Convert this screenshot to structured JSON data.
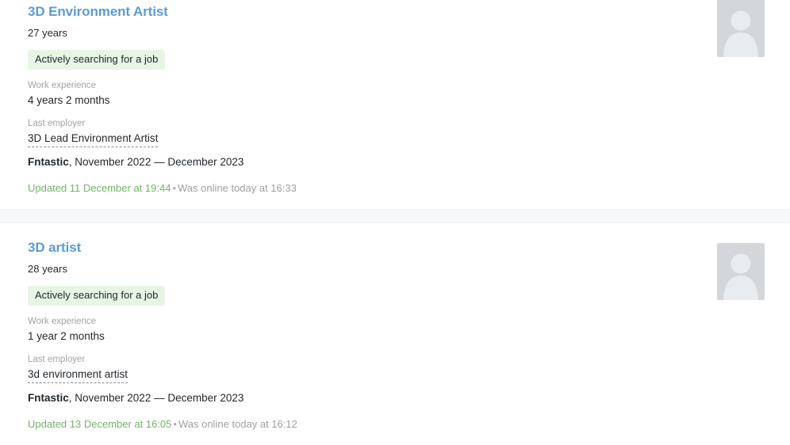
{
  "page": {
    "accent_blue": "#5b9bd5",
    "badge_bg": "#e7f5e5",
    "updated_green": "#73b369",
    "muted_gray": "#a3a3a3",
    "avatar_bg": "#d3d7d9",
    "divider_bg": "#f7f8fa"
  },
  "labels": {
    "work_experience": "Work experience",
    "last_employer": "Last employer",
    "separator": "•"
  },
  "resumes": [
    {
      "title": "3D Environment Artist",
      "age": "27 years",
      "status": "Actively searching for a job",
      "experience_label": "Work experience",
      "experience": "4 years 2 months",
      "employer_label": "Last employer",
      "position": "3D Lead Environment Artist",
      "company": "Fntastic",
      "period": ", November 2022 — December 2023",
      "updated": "Updated 11 December at 19:44",
      "separator": "•",
      "online": "Was online today at 16:33",
      "avatar_icon": "user-placeholder-icon"
    },
    {
      "title": "3D artist",
      "age": "28 years",
      "status": "Actively searching for a job",
      "experience_label": "Work experience",
      "experience": "1 year 2 months",
      "employer_label": "Last employer",
      "position": "3d environment artist",
      "company": "Fntastic",
      "period": ", November 2022 — December 2023",
      "updated": "Updated 13 December at 16:05",
      "separator": "•",
      "online": "Was online today at 16:12",
      "avatar_icon": "user-placeholder-icon"
    }
  ]
}
